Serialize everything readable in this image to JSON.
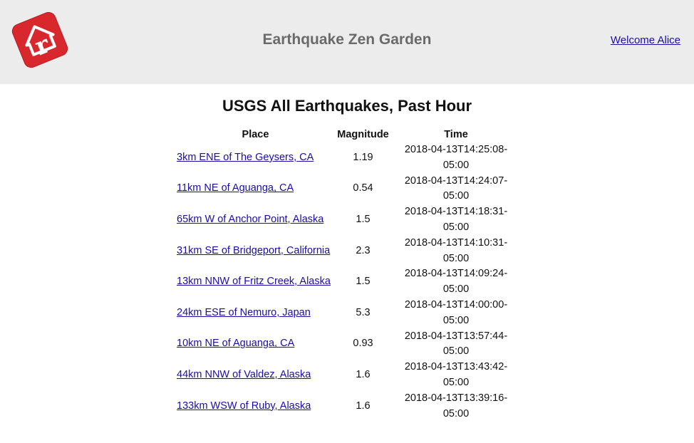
{
  "header": {
    "logo_letter": "r",
    "logo_color": "#d9272e",
    "title": "Earthquake Zen Garden",
    "welcome_link": "Welcome Alice"
  },
  "main": {
    "heading": "USGS All Earthquakes, Past Hour",
    "table": {
      "columns": [
        "Place",
        "Magnitude",
        "Time"
      ],
      "rows": [
        {
          "place": "3km ENE of The Geysers, CA",
          "magnitude": "1.19",
          "time": "2018-04-13T14:25:08-05:00"
        },
        {
          "place": "11km NE of Aguanga, CA",
          "magnitude": "0.54",
          "time": "2018-04-13T14:24:07-05:00"
        },
        {
          "place": "65km W of Anchor Point, Alaska",
          "magnitude": "1.5",
          "time": "2018-04-13T14:18:31-05:00"
        },
        {
          "place": "31km SE of Bridgeport, California",
          "magnitude": "2.3",
          "time": "2018-04-13T14:10:31-05:00"
        },
        {
          "place": "13km NNW of Fritz Creek, Alaska",
          "magnitude": "1.5",
          "time": "2018-04-13T14:09:24-05:00"
        },
        {
          "place": "24km ESE of Nemuro, Japan",
          "magnitude": "5.3",
          "time": "2018-04-13T14:00:00-05:00"
        },
        {
          "place": "10km NE of Aguanga, CA",
          "magnitude": "0.93",
          "time": "2018-04-13T13:57:44-05:00"
        },
        {
          "place": "44km NNW of Valdez, Alaska",
          "magnitude": "1.6",
          "time": "2018-04-13T13:43:42-05:00"
        },
        {
          "place": "133km WSW of Ruby, Alaska",
          "magnitude": "1.6",
          "time": "2018-04-13T13:39:16-05:00"
        }
      ]
    }
  }
}
